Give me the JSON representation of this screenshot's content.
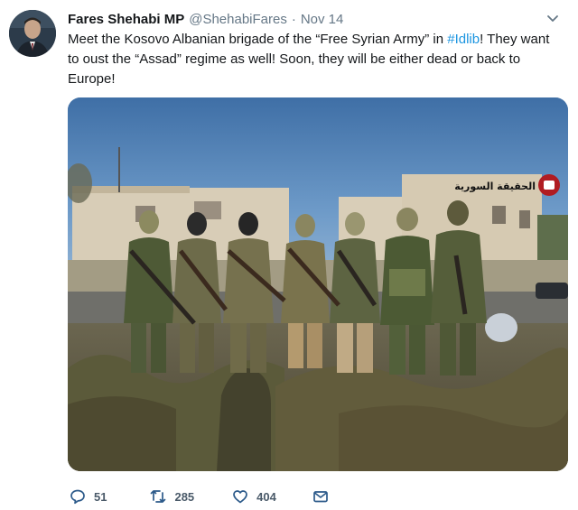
{
  "tweet": {
    "author_name": "Fares Shehabi MP",
    "handle": "@ShehabiFares",
    "separator": "·",
    "date": "Nov 14",
    "text_part1": "Meet the Kosovo Albanian brigade of the “Free Syrian Army” in ",
    "hashtag": "#Idlib",
    "text_part2": "! They want to oust the “Assad” regime as well! Soon, they will be either dead or back to Europe!"
  },
  "media": {
    "watermark_text": "الحقيقة السورية"
  },
  "actions": {
    "reply_count": "51",
    "retweet_count": "285",
    "like_count": "404"
  },
  "colors": {
    "link": "#1b95e0",
    "muted": "#657786",
    "text": "#14171a"
  },
  "icons": [
    "avatar",
    "chevron-down-icon",
    "reply-icon",
    "retweet-icon",
    "like-icon",
    "message-icon"
  ]
}
